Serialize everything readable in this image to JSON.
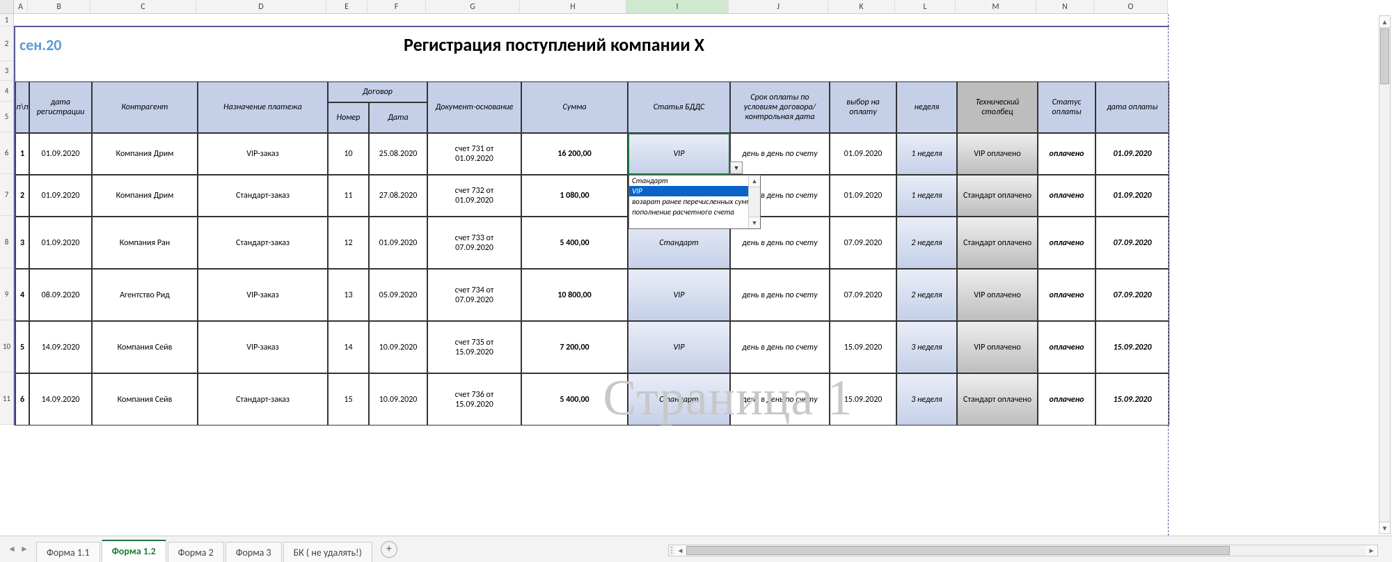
{
  "columnLetters": [
    "A",
    "B",
    "C",
    "D",
    "E",
    "F",
    "G",
    "H",
    "I",
    "J",
    "K",
    "L",
    "M",
    "N",
    "O"
  ],
  "activeColumn": "I",
  "rowNumbers": [
    "1",
    "2",
    "3",
    "4",
    "5",
    "6",
    "7",
    "8",
    "9",
    "10",
    "11"
  ],
  "title": {
    "month": "сен.20",
    "main": "Регистрация поступлений компании Х"
  },
  "watermark": "Страница 1",
  "headers": {
    "pp": "п\\п",
    "regDate": "дата регистрации",
    "counterparty": "Контрагент",
    "purpose": "Назначение платежа",
    "contract": "Договор",
    "contractNum": "Номер",
    "contractDate": "Дата",
    "docBasis": "Документ-основание",
    "sum": "Сумма",
    "bdds": "Статья БДДС",
    "paymentTerm": "Срок оплаты по условиям договора/ контрольная дата",
    "choice": "выбор на оплату",
    "week": "неделя",
    "tech": "Технический столбец",
    "status": "Статус оплаты",
    "payDate": "дата оплаты"
  },
  "rows": [
    {
      "n": "1",
      "reg": "01.09.2020",
      "cp": "Компания Дрим",
      "purp": "VIP-заказ",
      "num": "10",
      "cdate": "25.08.2020",
      "doc": "счет 731 от 01.09.2020",
      "sum": "16 200,00",
      "bdds": "VIP",
      "term": "день в день по счету",
      "choice": "01.09.2020",
      "week": "1 неделя",
      "tech": "VIP оплачено",
      "status": "оплачено",
      "pdate": "01.09.2020"
    },
    {
      "n": "2",
      "reg": "01.09.2020",
      "cp": "Компания Дрим",
      "purp": "Стандарт-заказ",
      "num": "11",
      "cdate": "27.08.2020",
      "doc": "счет 732 от 01.09.2020",
      "sum": "1 080,00",
      "bdds": "",
      "term": "день в день по счету",
      "choice": "01.09.2020",
      "week": "1 неделя",
      "tech": "Стандарт оплачено",
      "status": "оплачено",
      "pdate": "01.09.2020"
    },
    {
      "n": "3",
      "reg": "01.09.2020",
      "cp": "Компания Ран",
      "purp": "Стандарт-заказ",
      "num": "12",
      "cdate": "01.09.2020",
      "doc": "счет 733 от 07.09.2020",
      "sum": "5 400,00",
      "bdds": "Стандарт",
      "term": "день в день по счету",
      "choice": "07.09.2020",
      "week": "2 неделя",
      "tech": "Стандарт оплачено",
      "status": "оплачено",
      "pdate": "07.09.2020"
    },
    {
      "n": "4",
      "reg": "08.09.2020",
      "cp": "Агентство Рид",
      "purp": "VIP-заказ",
      "num": "13",
      "cdate": "05.09.2020",
      "doc": "счет 734 от 07.09.2020",
      "sum": "10 800,00",
      "bdds": "VIP",
      "term": "день в день по счету",
      "choice": "07.09.2020",
      "week": "2 неделя",
      "tech": "VIP оплачено",
      "status": "оплачено",
      "pdate": "07.09.2020"
    },
    {
      "n": "5",
      "reg": "14.09.2020",
      "cp": "Компания Сейв",
      "purp": "VIP-заказ",
      "num": "14",
      "cdate": "10.09.2020",
      "doc": "счет 735 от 15.09.2020",
      "sum": "7 200,00",
      "bdds": "VIP",
      "term": "день в день по счету",
      "choice": "15.09.2020",
      "week": "3 неделя",
      "tech": "VIP оплачено",
      "status": "оплачено",
      "pdate": "15.09.2020"
    },
    {
      "n": "6",
      "reg": "14.09.2020",
      "cp": "Компания Сейв",
      "purp": "Стандарт-заказ",
      "num": "15",
      "cdate": "10.09.2020",
      "doc": "счет 736 от 15.09.2020",
      "sum": "5 400,00",
      "bdds": "Стандарт",
      "term": "день в день по счету",
      "choice": "15.09.2020",
      "week": "3 неделя",
      "tech": "Стандарт оплачено",
      "status": "оплачено",
      "pdate": "15.09.2020"
    }
  ],
  "dropdown": {
    "options": [
      "Стандарт",
      "VIP",
      "возврат ранее перечисленных сумм",
      "пополнение расчетного счета"
    ],
    "selected": "VIP"
  },
  "tabs": [
    "Форма 1.1",
    "Форма 1.2",
    "Форма 2",
    "Форма 3",
    "БК ( не удалять!)"
  ],
  "activeTab": "Форма 1.2"
}
